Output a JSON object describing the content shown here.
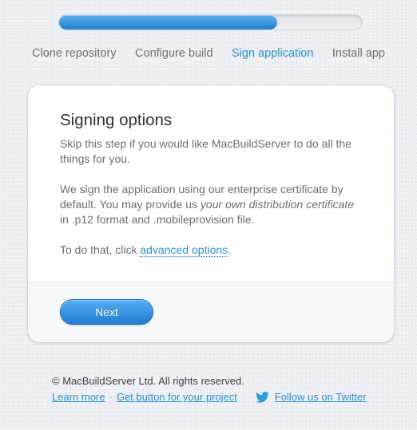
{
  "progress": {
    "fraction": 0.72
  },
  "steps": [
    {
      "label": "Clone repository",
      "active": false
    },
    {
      "label": "Configure build",
      "active": false
    },
    {
      "label": "Sign application",
      "active": true
    },
    {
      "label": "Install app",
      "active": false
    }
  ],
  "card": {
    "title": "Signing options",
    "skip_text": "Skip this step if you would like MacBuildServer to do all the things for you.",
    "sign_text_1": "We sign the application using our enterprise certificate by default. You may provide us ",
    "sign_text_em": "your own distribution certificate",
    "sign_text_2": " in .p12 format and .mobileprovision file.",
    "advanced_prefix": "To do that, click ",
    "advanced_link": "advanced options",
    "advanced_suffix": ".",
    "next_label": "Next"
  },
  "footer": {
    "copyright": "© MacBuildServer Ltd. All rights reserved.",
    "learn_more": "Learn more",
    "separator": "·",
    "get_button": "Get button for your project",
    "twitter_label": "Follow us on Twitter",
    "twitter_icon": "twitter-bird-icon"
  },
  "colors": {
    "accent": "#2b8fcf",
    "button_top": "#57aef0",
    "button_bottom": "#1e7ed3",
    "progress_fill": "#1f7fd0",
    "twitter": "#2a9fd6"
  }
}
